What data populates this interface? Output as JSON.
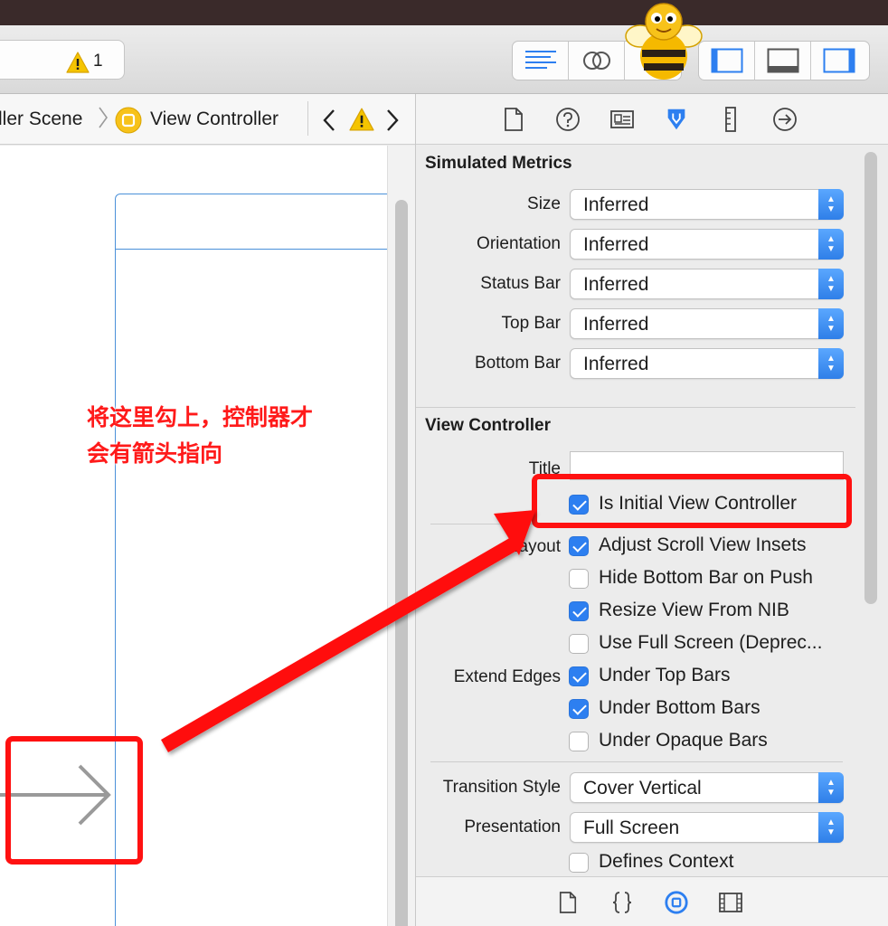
{
  "toolbar": {
    "status_warning_count": "1",
    "editor_mode_icons": [
      "standard-editor-icon",
      "assistant-editor-icon",
      "version-editor-icon"
    ],
    "panel_toggle_icons": [
      "left-panel-icon",
      "bottom-panel-icon",
      "right-panel-icon"
    ]
  },
  "jumpbar": {
    "scene_label": "ller Scene",
    "controller_label": "View Controller"
  },
  "annotation": {
    "line1": "将这里勾上，控制器才",
    "line2": "会有箭头指向"
  },
  "inspector": {
    "tabs": [
      "file-inspector-icon",
      "quick-help-icon",
      "identity-inspector-icon",
      "attributes-inspector-icon",
      "size-inspector-icon",
      "connections-inspector-icon"
    ],
    "simulated_metrics": {
      "header": "Simulated Metrics",
      "size_label": "Size",
      "size_value": "Inferred",
      "orientation_label": "Orientation",
      "orientation_value": "Inferred",
      "status_bar_label": "Status Bar",
      "status_bar_value": "Inferred",
      "top_bar_label": "Top Bar",
      "top_bar_value": "Inferred",
      "bottom_bar_label": "Bottom Bar",
      "bottom_bar_value": "Inferred"
    },
    "view_controller": {
      "header": "View Controller",
      "title_label": "Title",
      "title_value": "",
      "is_initial_label": "Is Initial View Controller",
      "is_initial_checked": true,
      "layout_label": "Layout",
      "adjust_scroll_label": "Adjust Scroll View Insets",
      "adjust_scroll_checked": true,
      "hide_bottom_bar_label": "Hide Bottom Bar on Push",
      "hide_bottom_bar_checked": false,
      "resize_nib_label": "Resize View From NIB",
      "resize_nib_checked": true,
      "use_full_screen_label": "Use Full Screen (Deprec...",
      "use_full_screen_checked": false,
      "extend_edges_label": "Extend Edges",
      "under_top_bars_label": "Under Top Bars",
      "under_top_bars_checked": true,
      "under_bottom_bars_label": "Under Bottom Bars",
      "under_bottom_bars_checked": true,
      "under_opaque_bars_label": "Under Opaque Bars",
      "under_opaque_bars_checked": false,
      "transition_style_label": "Transition Style",
      "transition_style_value": "Cover Vertical",
      "presentation_label": "Presentation",
      "presentation_value": "Full Screen",
      "defines_context_label": "Defines Context",
      "defines_context_checked": false
    },
    "library_tabs": [
      "file-template-library-icon",
      "code-snippet-library-icon",
      "object-library-icon",
      "media-library-icon"
    ]
  },
  "colors": {
    "annotation_red": "#ff1111",
    "accent_blue": "#2d7ff0",
    "warning_yellow": "#f5c400",
    "frame_blue": "#4a90d9"
  }
}
